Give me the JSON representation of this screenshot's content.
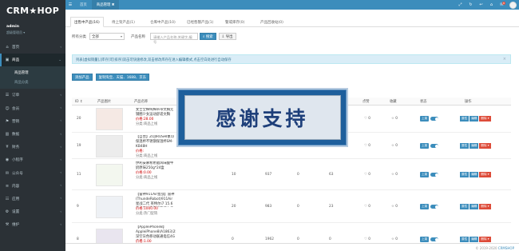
{
  "sidebar": {
    "logo": "CRM★HOP",
    "user_name": "admin",
    "user_role": "超级管理员 ▾",
    "items": [
      {
        "icon": "home-icon",
        "glyph": "⌂",
        "label": "首页"
      },
      {
        "icon": "shop-icon",
        "glyph": "▣",
        "label": "商品",
        "active": true
      },
      {
        "icon": "order-icon",
        "glyph": "☰",
        "label": "订单"
      },
      {
        "icon": "member-icon",
        "glyph": "☺",
        "label": "会员"
      },
      {
        "icon": "marketing-icon",
        "glyph": "⚑",
        "label": "营销"
      },
      {
        "icon": "data-icon",
        "glyph": "▥",
        "label": "数据"
      },
      {
        "icon": "finance-icon",
        "glyph": "¥",
        "label": "财务"
      },
      {
        "icon": "miniapp-icon",
        "glyph": "◉",
        "label": "小程序"
      },
      {
        "icon": "wechat-icon",
        "glyph": "✉",
        "label": "公众号"
      },
      {
        "icon": "content-icon",
        "glyph": "≡",
        "label": "内容"
      },
      {
        "icon": "app-icon",
        "glyph": "☷",
        "label": "应用"
      },
      {
        "icon": "settings-icon",
        "glyph": "⚙",
        "label": "设置"
      },
      {
        "icon": "maintain-icon",
        "glyph": "⚒",
        "label": "维护"
      }
    ],
    "sub_items": [
      "商品管理",
      "商品分类"
    ]
  },
  "topbar": {
    "tabs": [
      "首页",
      "商品管理 ✖"
    ],
    "right_icons": [
      "expand-icon",
      "refresh-icon",
      "back-icon",
      "home-icon",
      "bell-icon"
    ],
    "badge": "8"
  },
  "subtabs": [
    "出售中产品(16)",
    "待上架产品(1)",
    "仓库中产品(10)",
    "已经售罄产品(1)",
    "警戒库存(0)",
    "产品回收站(0)"
  ],
  "filter": {
    "label": "所有分类",
    "select_value": "全部",
    "name_label": "产品名称",
    "name_placeholder": "请输入产品名称,关键字,编号",
    "search_label": "⌕ 搜索",
    "export_label": "⇩ 导出"
  },
  "alert": "列表[虚拟销量],[库存]可[排序]双击可快速修改,双击修改库存在进入编辑模式,点击空白处进行自动保存",
  "actions": {
    "add": "添加产品",
    "batch": "复制淘宝、天猫、1688、京东"
  },
  "table": {
    "headers": [
      "ID ↕",
      "产品图片",
      "产品名称",
      "价格",
      "销量",
      "库存",
      "虚拟销量",
      "点赞",
      "收藏",
      "状态",
      "操作"
    ],
    "rows": [
      {
        "id": "20",
        "name": "女士全棉纯棉吊带文胸无钢圈少女运动舒适文胸",
        "price": "价格:28.00",
        "cat": "分类:商品上线",
        "price_val": "",
        "sales": "",
        "stock": "",
        "virtual": "",
        "likes": "0",
        "favs": "0"
      },
      {
        "id": "19",
        "name": "【自营】ZOJIRUSHI象印保温杯不锈钢保温杯SM-KB48H",
        "price": "价格:",
        "cat": "分类:商品上线",
        "price_val": "",
        "sales": "",
        "stock": "",
        "virtual": "",
        "likes": "0",
        "favs": "0"
      },
      {
        "id": "11",
        "name": "伊利安慕希希腊风味酸牛奶原味250g*24盒",
        "price": "价格:0.00",
        "cat": "分类:商品上线",
        "price_val": "10",
        "sales": "937",
        "stock": "0",
        "virtual": "63",
        "likes": "0",
        "favs": "0"
      },
      {
        "id": "9",
        "name": "【雷神911Air星战】雷神(ThundeRobot)911Air星战二代 英特尔i7 15.6英寸窄边框游戏笔记本电脑",
        "price": "价格:1000.00",
        "cat": "分类:热门促销",
        "price_val": "20",
        "sales": "983",
        "stock": "0",
        "virtual": "23",
        "likes": "0",
        "favs": "0"
      },
      {
        "id": "8",
        "name": "【AppleiPhone8】AppleiPhone8(A1863)256GB深空灰色移动联通电信4G手机",
        "price": "价格:1.00",
        "cat": "分类:商品上线",
        "price_val": "0",
        "sales": "1962",
        "stock": "0",
        "virtual": "0",
        "likes": "0",
        "favs": "0"
      }
    ],
    "status_tag": "上架",
    "ops": [
      "属性",
      "编辑",
      "删除 ▾"
    ]
  },
  "overlay_text": "感谢支持",
  "footer": {
    "copyright": "© 2019-2020 ",
    "brand": "CRMSHOP"
  }
}
